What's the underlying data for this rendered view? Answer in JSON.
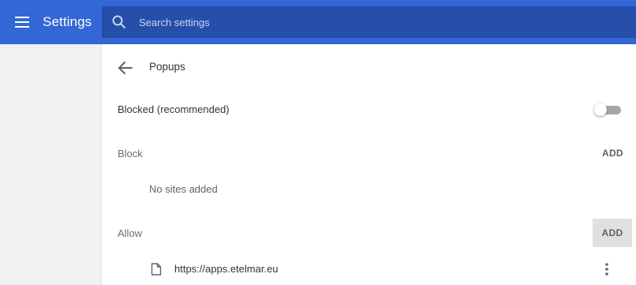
{
  "header": {
    "title": "Settings",
    "search_placeholder": "Search settings",
    "menu_icon": "hamburger-menu-icon",
    "search_icon": "search-icon",
    "colors": {
      "bar": "#3367d6",
      "search_bg": "#254fa8"
    }
  },
  "page": {
    "title": "Popups",
    "back_icon": "arrow-back-icon"
  },
  "setting": {
    "label": "Blocked (recommended)",
    "toggle_on": false
  },
  "block_section": {
    "label": "Block",
    "add_label": "ADD",
    "empty_text": "No sites added"
  },
  "allow_section": {
    "label": "Allow",
    "add_label": "ADD",
    "sites": [
      {
        "url": "https://apps.etelmar.eu",
        "icon": "file-icon",
        "menu_icon": "more-vert-icon"
      }
    ]
  }
}
